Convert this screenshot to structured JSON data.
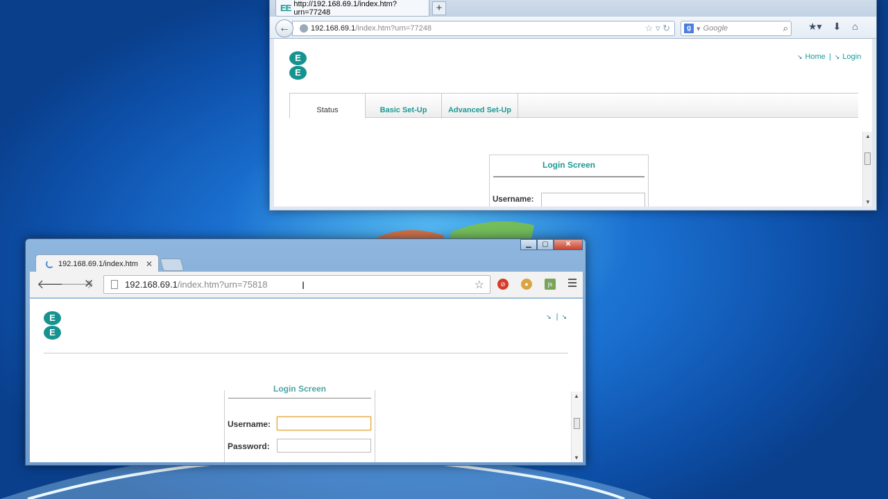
{
  "firefox": {
    "tab_title": "http://192.168.69.1/index.htm?urn=77248",
    "tab_icon": "EE",
    "new_tab": "+",
    "url_host": "192.168.69.1",
    "url_path": "/index.htm?urn=77248",
    "search_engine": "g",
    "search_placeholder": "Google",
    "page": {
      "logo_letters": [
        "E",
        "E"
      ],
      "links": {
        "home": "Home",
        "separator": "|",
        "login": "Login"
      },
      "tabs": [
        "Status",
        "Basic Set-Up",
        "Advanced Set-Up"
      ],
      "login_title": "Login Screen",
      "username_label": "Username:"
    }
  },
  "chrome": {
    "tab_title": "192.168.69.1/index.htm",
    "tab_close": "✕",
    "url_host": "192.168.69.1",
    "url_path": "/index.htm?urn=75818",
    "window_buttons": {
      "minimize": "▁",
      "maximize": "▢",
      "close": "✕"
    },
    "page": {
      "logo_letters": [
        "E",
        "E"
      ],
      "links_separator": "|",
      "login_title": "Login Screen",
      "username_label": "Username:",
      "password_label": "Password:"
    }
  },
  "colors": {
    "ee_teal": "#17938f",
    "link_teal": "#1a9a96",
    "desktop_blue": "#1a6fcf"
  }
}
